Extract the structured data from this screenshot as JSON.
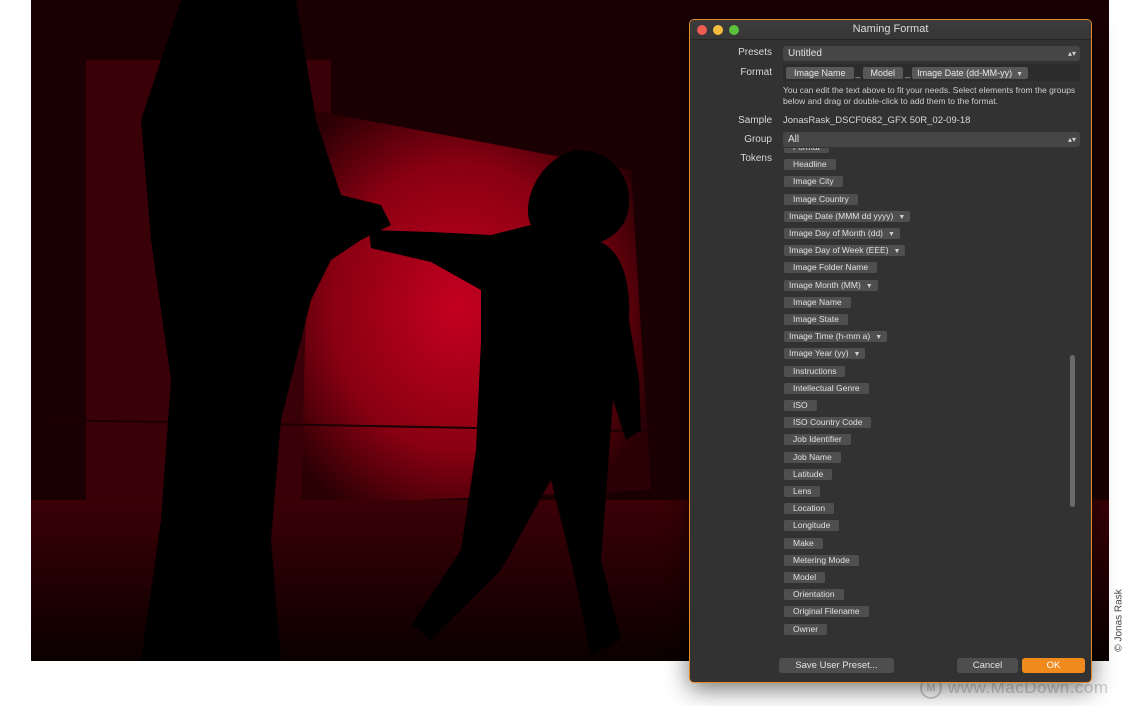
{
  "dialog": {
    "title": "Naming Format",
    "presets_label": "Presets",
    "presets_value": "Untitled",
    "format_label": "Format",
    "format_tokens": [
      "Image Name",
      "Model",
      "Image Date (dd-MM-yy)"
    ],
    "format_separator": "_",
    "help_text": "You can edit the text above to fit your needs. Select elements from the groups below and drag or double-click to add them to the format.",
    "sample_label": "Sample",
    "sample_value": "JonasRask_DSCF0682_GFX 50R_02-09-18",
    "group_label": "Group",
    "group_value": "All",
    "tokens_label": "Tokens",
    "tokens": [
      {
        "label": "Format",
        "dropdown": false
      },
      {
        "label": "Headline",
        "dropdown": false
      },
      {
        "label": "Image City",
        "dropdown": false
      },
      {
        "label": "Image Country",
        "dropdown": false
      },
      {
        "label": "Image Date (MMM dd yyyy)",
        "dropdown": true
      },
      {
        "label": "Image Day of Month (dd)",
        "dropdown": true
      },
      {
        "label": "Image Day of Week (EEE)",
        "dropdown": true
      },
      {
        "label": "Image Folder Name",
        "dropdown": false
      },
      {
        "label": "Image Month (MM)",
        "dropdown": true
      },
      {
        "label": "Image Name",
        "dropdown": false
      },
      {
        "label": "Image State",
        "dropdown": false
      },
      {
        "label": "Image Time (h-mm a)",
        "dropdown": true
      },
      {
        "label": "Image Year (yy)",
        "dropdown": true
      },
      {
        "label": "Instructions",
        "dropdown": false
      },
      {
        "label": "Intellectual Genre",
        "dropdown": false
      },
      {
        "label": "ISO",
        "dropdown": false
      },
      {
        "label": "ISO Country Code",
        "dropdown": false
      },
      {
        "label": "Job Identifier",
        "dropdown": false
      },
      {
        "label": "Job Name",
        "dropdown": false
      },
      {
        "label": "Latitude",
        "dropdown": false
      },
      {
        "label": "Lens",
        "dropdown": false
      },
      {
        "label": "Location",
        "dropdown": false
      },
      {
        "label": "Longitude",
        "dropdown": false
      },
      {
        "label": "Make",
        "dropdown": false
      },
      {
        "label": "Metering Mode",
        "dropdown": false
      },
      {
        "label": "Model",
        "dropdown": false
      },
      {
        "label": "Orientation",
        "dropdown": false
      },
      {
        "label": "Original Filename",
        "dropdown": false
      },
      {
        "label": "Owner",
        "dropdown": false
      }
    ],
    "save_preset_label": "Save User Preset...",
    "cancel_label": "Cancel",
    "ok_label": "OK"
  },
  "credit": "© Jonas Rask",
  "watermark": "www.MacDown.com",
  "colors": {
    "accent": "#f08a1c",
    "dialog_bg": "#323232",
    "token_bg": "#4f4f4f",
    "photo_red": "#c0001a"
  },
  "icons": {
    "close": "close-button-icon",
    "minimize": "minimize-button-icon",
    "zoom": "zoom-button-icon",
    "stepper": "up-down-chevron-icon",
    "dropdown": "chevron-down-icon"
  }
}
